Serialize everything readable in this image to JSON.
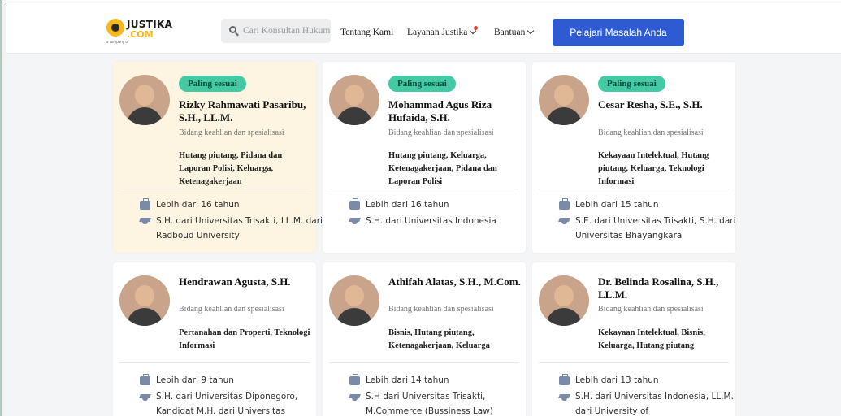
{
  "header": {
    "logo_text": "JUSTIKA",
    "logo_sub": ".COM",
    "logo_tag": "a company of",
    "search_placeholder": "Cari Konsultan Hukum",
    "nav": [
      {
        "label": "Tentang Kami"
      },
      {
        "label": "Layanan Justika"
      },
      {
        "label": "Bantuan"
      }
    ],
    "cta_label": "Pelajari Masalah Anda"
  },
  "cards": [
    {
      "badge": "Paling sesuai",
      "name": "Rizky Rahmawati Pasaribu, S.H., LL.M.",
      "spec_label": "Bidang keahlian dan spesialisasi",
      "spec": "Hutang piutang, Pidana dan Laporan Polisi, Keluarga, Ketenagakerjaan",
      "experience": "Lebih dari 16 tahun",
      "education": "S.H. dari Universitas Trisakti, LL.M. dari Radboud University"
    },
    {
      "badge": "Paling sesuai",
      "name": "Mohammad Agus Riza Hufaida, S.H.",
      "spec_label": "Bidang keahlian dan spesialisasi",
      "spec": "Hutang piutang, Keluarga, Ketenagakerjaan, Pidana dan Laporan Polisi",
      "experience": "Lebih dari 16 tahun",
      "education": "S.H. dari Universitas Indonesia"
    },
    {
      "badge": "Paling sesuai",
      "name": "Cesar Resha, S.E., S.H.",
      "spec_label": "Bidang keahlian dan spesialisasi",
      "spec": "Kekayaan Intelektual, Hutang piutang, Keluarga, Teknologi Informasi",
      "experience": "Lebih dari 15 tahun",
      "education": "S.E. dari Universitas Trisakti, S.H. dari Universitas Bhayangkara"
    },
    {
      "name": "Hendrawan Agusta, S.H.",
      "spec_label": "Bidang keahlian dan spesialisasi",
      "spec": "Pertanahan dan Properti, Teknologi Informasi",
      "experience": "Lebih dari 9 tahun",
      "education": "S.H. dari Universitas Diponegoro, Kandidat M.H. dari Universitas"
    },
    {
      "name": "Athifah Alatas, S.H., M.Com.",
      "spec_label": "Bidang keahlian dan spesialisasi",
      "spec": "Bisnis, Hutang piutang, Ketenagakerjaan, Keluarga",
      "experience": "Lebih dari 14 tahun",
      "education": "S.H dari Universitas Trisakti, M.Commerce (Bussiness Law)"
    },
    {
      "name": "Dr. Belinda Rosalina, S.H., LL.M.",
      "spec_label": "Bidang keahlian dan spesialisasi",
      "spec": "Kekayaan Intelektual, Bisnis, Keluarga, Hutang piutang",
      "experience": "Lebih dari 13 tahun",
      "education": "S.H. dari Universitas Indonesia, LL.M. dari University of"
    }
  ]
}
